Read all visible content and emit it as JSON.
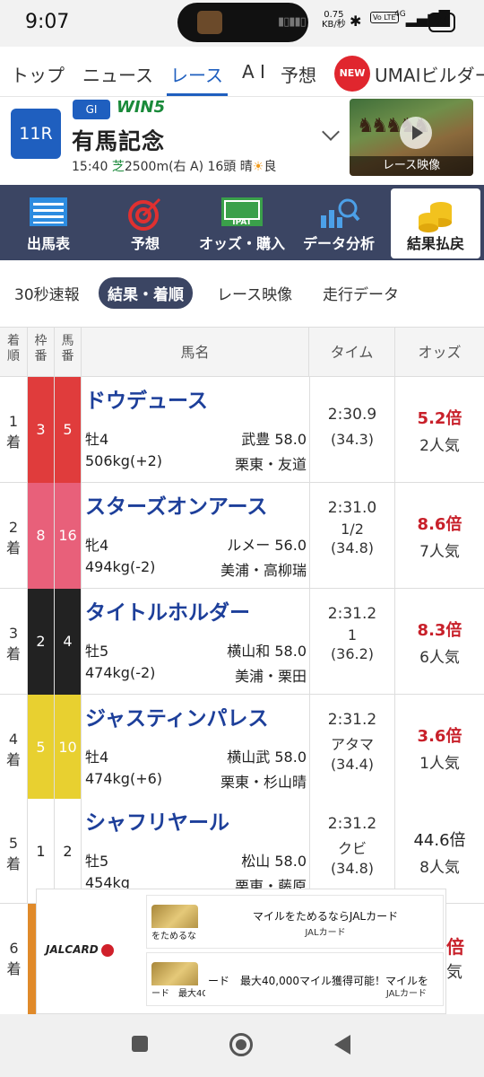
{
  "status": {
    "time": "9:07",
    "net_speed": "0.75",
    "net_unit": "KB/秒",
    "volte": "Vo LTE",
    "signal": "4G",
    "battery": "84"
  },
  "topnav": {
    "items": [
      "トップ",
      "ニュース",
      "レース",
      "A I",
      "予想"
    ],
    "active": "レース",
    "new_badge": "NEW",
    "umai": "UMAIビルダー"
  },
  "race": {
    "number": "11R",
    "grade": "GI",
    "win5": "WIN5",
    "name": "有馬記念",
    "start_time": "15:40",
    "surface": "芝",
    "distance": "2500m(右 A)",
    "runners": "16頭",
    "weather": "晴",
    "going": "良",
    "video_label": "レース映像"
  },
  "tools": [
    {
      "label": "出馬表",
      "icon": "entry-table-icon"
    },
    {
      "label": "予想",
      "icon": "target-icon"
    },
    {
      "label": "オッズ・購入",
      "icon": "ipat-icon"
    },
    {
      "label": "データ分析",
      "icon": "chart-search-icon"
    },
    {
      "label": "結果払戻",
      "icon": "coins-icon"
    }
  ],
  "ipat_text": "IPAT",
  "subtabs": [
    "30秒速報",
    "結果・着順",
    "レース映像",
    "走行データ"
  ],
  "table": {
    "headers": {
      "rank": "着順",
      "waku": "枠番",
      "uma": "馬番",
      "horse": "馬名",
      "time": "タイム",
      "odds": "オッズ"
    },
    "rows": [
      {
        "rank": "1",
        "rank_suffix": "着",
        "waku": "3",
        "uma": "5",
        "name": "ドウデュース",
        "sex_age": "牡4",
        "jockey": "武豊",
        "kinryo": "58.0",
        "weight": "506kg(+2)",
        "trainer": "栗東・友道",
        "time": "2:30.9",
        "margin": "",
        "last3f": "(34.3)",
        "odds": "5.2倍",
        "pop": "2人気"
      },
      {
        "rank": "2",
        "rank_suffix": "着",
        "waku": "8",
        "uma": "16",
        "name": "スターズオンアース",
        "sex_age": "牝4",
        "jockey": "ルメー",
        "kinryo": "56.0",
        "weight": "494kg(-2)",
        "trainer": "美浦・高柳瑞",
        "time": "2:31.0",
        "margin": "1/2",
        "last3f": "(34.8)",
        "odds": "8.6倍",
        "pop": "7人気"
      },
      {
        "rank": "3",
        "rank_suffix": "着",
        "waku": "2",
        "uma": "4",
        "name": "タイトルホルダー",
        "sex_age": "牡5",
        "jockey": "横山和",
        "kinryo": "58.0",
        "weight": "474kg(-2)",
        "trainer": "美浦・栗田",
        "time": "2:31.2",
        "margin": "1",
        "last3f": "(36.2)",
        "odds": "8.3倍",
        "pop": "6人気"
      },
      {
        "rank": "4",
        "rank_suffix": "着",
        "waku": "5",
        "uma": "10",
        "name": "ジャスティンパレス",
        "sex_age": "牡4",
        "jockey": "横山武",
        "kinryo": "58.0",
        "weight": "474kg(+6)",
        "trainer": "栗東・杉山晴",
        "time": "2:31.2",
        "margin": "アタマ",
        "last3f": "(34.4)",
        "odds": "3.6倍",
        "pop": "1人気"
      },
      {
        "rank": "5",
        "rank_suffix": "着",
        "waku": "1",
        "uma": "2",
        "name": "シャフリヤール",
        "sex_age": "牡5",
        "jockey": "松山",
        "kinryo": "58.0",
        "weight": "454kg",
        "trainer": "栗東・藤原",
        "time": "2:31.2",
        "margin": "クビ",
        "last3f": "(34.8)",
        "odds": "44.6倍",
        "pop": "8人気"
      }
    ],
    "partial_row": {
      "rank": "6",
      "rank_suffix": "着"
    }
  },
  "colors": {
    "waku": {
      "1": "#ffffff",
      "2": "#222222",
      "3": "#e03c3c",
      "4": "#2a62c8",
      "5": "#e8d030",
      "6": "#2aa04a",
      "7": "#f0902a",
      "8": "#e8607a"
    },
    "accent": "#1f5fbf",
    "toolbar": "#3b4563",
    "odds_fav": "#c8202a"
  },
  "ad": {
    "brand": "JALCARD",
    "card1_clip": "をためるな",
    "card1_title": "マイルをためるならJALカード",
    "card1_sub": "JALカード",
    "card2_clip": "ード　最大40",
    "card2_title": "ード　最大40,000マイル獲得可能！マイルを",
    "card2_sub": "JALカード"
  }
}
